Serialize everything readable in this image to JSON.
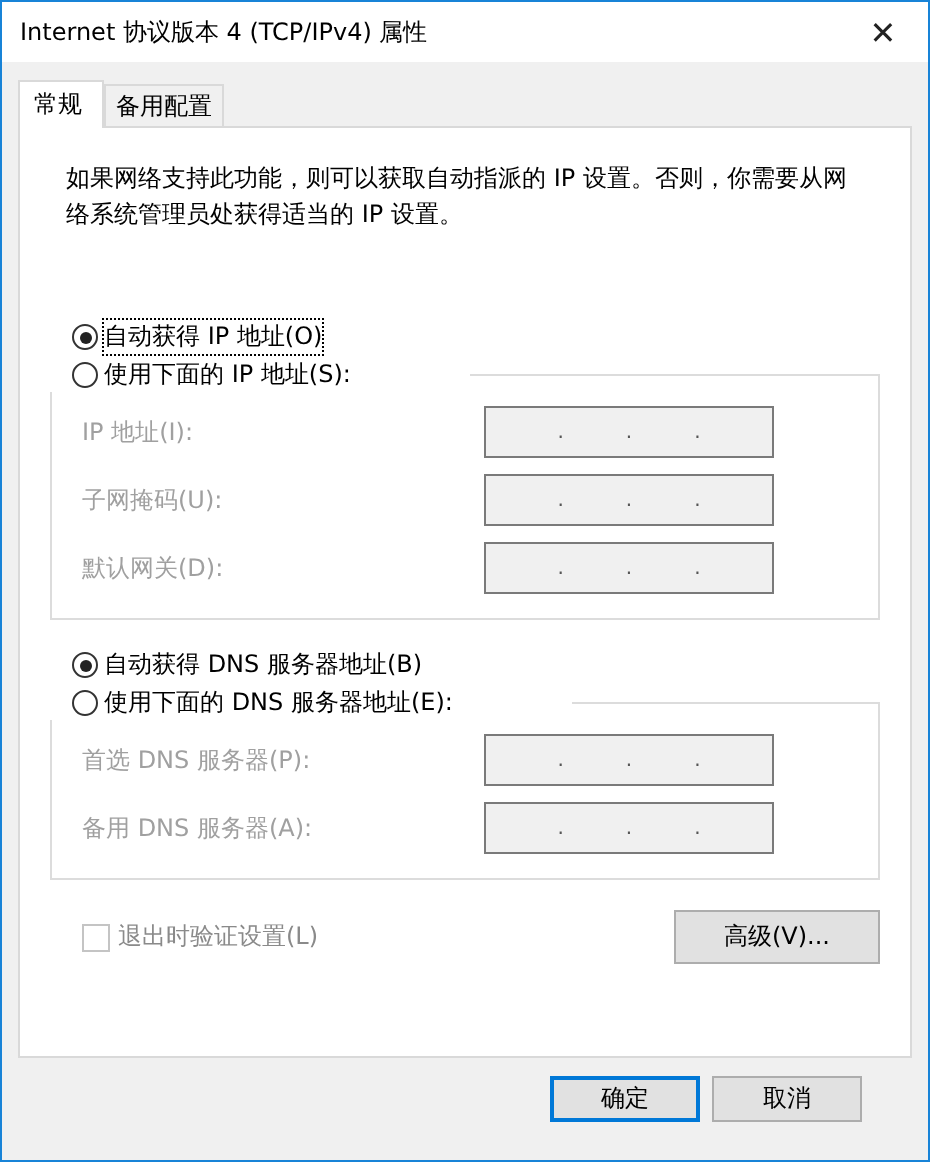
{
  "window": {
    "title": "Internet 协议版本 4 (TCP/IPv4) 属性",
    "close": "✕"
  },
  "tabs": [
    {
      "label": "常规",
      "selected": true
    },
    {
      "label": "备用配置",
      "selected": false
    }
  ],
  "description": "如果网络支持此功能，则可以获取自动指派的 IP 设置。否则，你需要从网络系统管理员处获得适当的 IP 设置。",
  "sections": [
    {
      "auto_option": {
        "label": "自动获得 IP 地址(O)",
        "selected": true,
        "focused": true
      },
      "manual_option": {
        "label": "使用下面的 IP 地址(S):",
        "selected": false
      },
      "fields": [
        {
          "label": "IP 地址(I):",
          "disabled": true,
          "dots": [
            ".",
            ".",
            "."
          ]
        },
        {
          "label": "子网掩码(U):",
          "disabled": true,
          "dots": [
            ".",
            ".",
            "."
          ]
        },
        {
          "label": "默认网关(D):",
          "disabled": true,
          "dots": [
            ".",
            ".",
            "."
          ]
        }
      ]
    },
    {
      "auto_option": {
        "label": "自动获得 DNS 服务器地址(B)",
        "selected": true,
        "focused": false
      },
      "manual_option": {
        "label": "使用下面的 DNS 服务器地址(E):",
        "selected": false
      },
      "fields": [
        {
          "label": "首选 DNS 服务器(P):",
          "disabled": true,
          "dots": [
            ".",
            ".",
            "."
          ]
        },
        {
          "label": "备用 DNS 服务器(A):",
          "disabled": true,
          "dots": [
            ".",
            ".",
            "."
          ]
        }
      ]
    }
  ],
  "validate_checkbox": {
    "label": "退出时验证设置(L)",
    "checked": false,
    "disabled": true
  },
  "advanced_button": {
    "label": "高级(V)..."
  },
  "buttons": [
    {
      "label": "确定",
      "default": true
    },
    {
      "label": "取消",
      "default": false
    }
  ]
}
